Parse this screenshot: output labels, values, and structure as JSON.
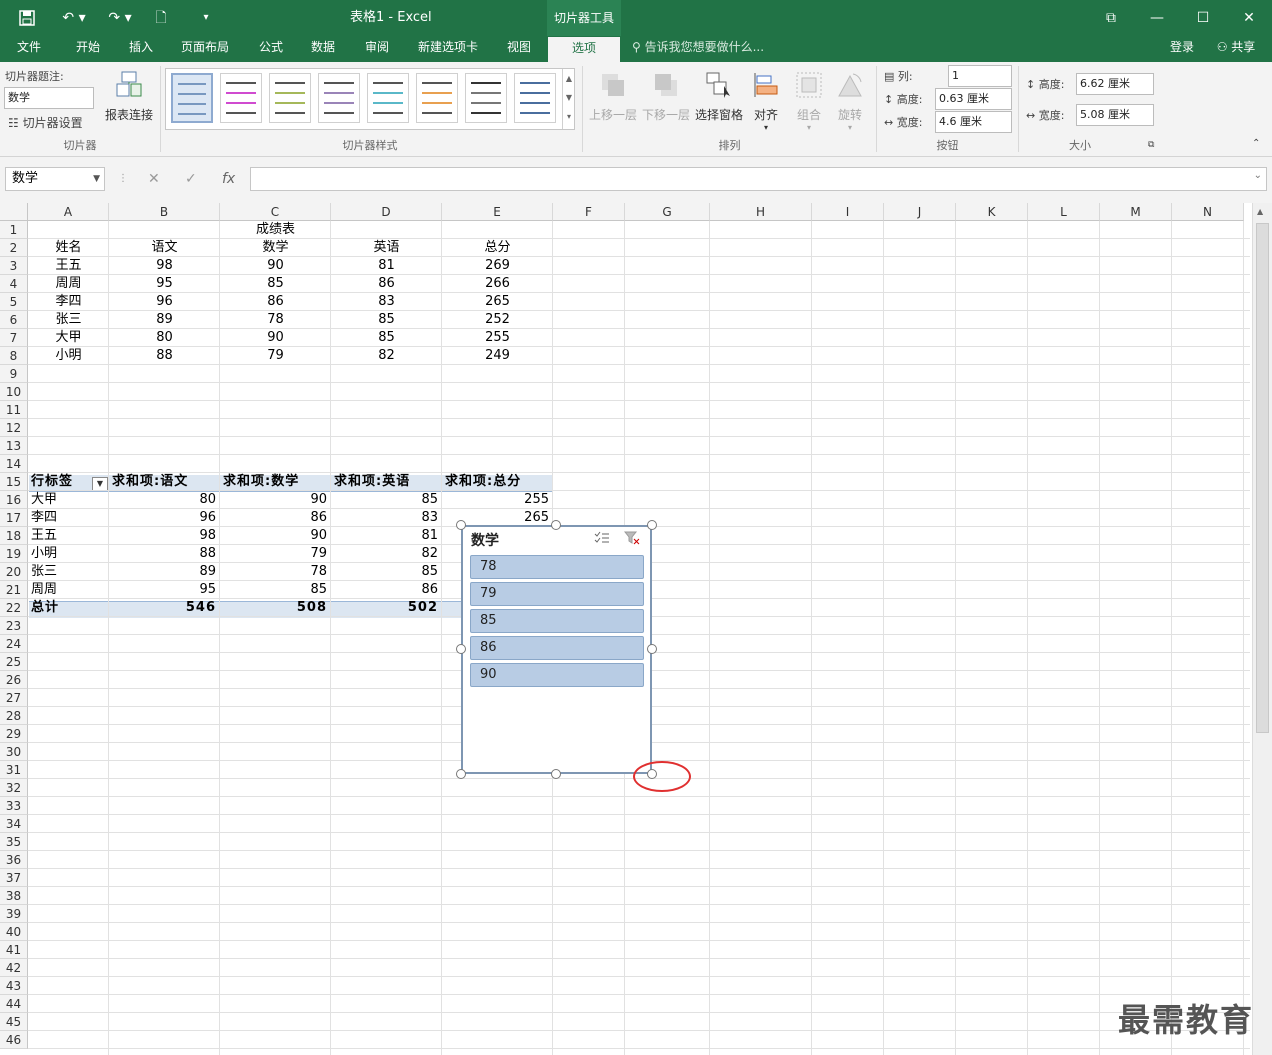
{
  "title": {
    "doc": "表格1 - Excel",
    "context_tab": "切片器工具",
    "login": "登录",
    "share": "共享"
  },
  "menu": {
    "file": "文件",
    "home": "开始",
    "insert": "插入",
    "layout": "页面布局",
    "formula": "公式",
    "data": "数据",
    "review": "审阅",
    "newtab": "新建选项卡",
    "view": "视图",
    "options": "选项",
    "tell": "告诉我您想要做什么..."
  },
  "ribbon": {
    "caption_label": "切片器题注:",
    "caption_value": "数学",
    "settings": "切片器设置",
    "report_conn": "报表连接",
    "group_slicer": "切片器",
    "group_styles": "切片器样式",
    "bring_forward": "上移一层",
    "send_backward": "下移一层",
    "selection_pane": "选择窗格",
    "align": "对齐",
    "group": "组合",
    "rotate": "旋转",
    "group_arrange": "排列",
    "columns_label": "列:",
    "columns_value": "1",
    "btn_height_label": "高度:",
    "btn_height_value": "0.63 厘米",
    "btn_width_label": "宽度:",
    "btn_width_value": "4.6 厘米",
    "group_buttons": "按钮",
    "size_height_label": "高度:",
    "size_height_value": "6.62 厘米",
    "size_width_label": "宽度:",
    "size_width_value": "5.08 厘米",
    "group_size": "大小"
  },
  "formula_bar": {
    "name_box": "数学",
    "fx": "fx",
    "cancel": "✕",
    "enter": "✓"
  },
  "colors": {
    "excel_green": "#217346",
    "slicer_item": "#b8cce4",
    "pivot_header": "#dce6f1"
  },
  "columns": [
    "A",
    "B",
    "C",
    "D",
    "E",
    "F",
    "G",
    "H",
    "I",
    "J",
    "K",
    "L",
    "M",
    "N"
  ],
  "rows": [
    "1",
    "2",
    "3",
    "4",
    "5",
    "6",
    "7",
    "8",
    "9",
    "10",
    "11",
    "12",
    "13",
    "14",
    "15",
    "16",
    "17",
    "18",
    "19",
    "20",
    "21",
    "22",
    "23",
    "24",
    "25",
    "26",
    "27",
    "28",
    "29",
    "30",
    "31",
    "32",
    "33",
    "34",
    "35",
    "36",
    "37",
    "38",
    "39",
    "40",
    "41",
    "42",
    "43",
    "44",
    "45",
    "46"
  ],
  "sheet": {
    "title": "成绩表",
    "headers": [
      "姓名",
      "语文",
      "数学",
      "英语",
      "总分"
    ],
    "data": [
      [
        "王五",
        "98",
        "90",
        "81",
        "269"
      ],
      [
        "周周",
        "95",
        "85",
        "86",
        "266"
      ],
      [
        "李四",
        "96",
        "86",
        "83",
        "265"
      ],
      [
        "张三",
        "89",
        "78",
        "85",
        "252"
      ],
      [
        "大甲",
        "80",
        "90",
        "85",
        "255"
      ],
      [
        "小明",
        "88",
        "79",
        "82",
        "249"
      ]
    ]
  },
  "pivot": {
    "headers": [
      "行标签",
      "求和项:语文",
      "求和项:数学",
      "求和项:英语",
      "求和项:总分"
    ],
    "rows": [
      [
        "大甲",
        "80",
        "90",
        "85",
        "255"
      ],
      [
        "李四",
        "96",
        "86",
        "83",
        "265"
      ],
      [
        "王五",
        "98",
        "90",
        "81",
        ""
      ],
      [
        "小明",
        "88",
        "79",
        "82",
        ""
      ],
      [
        "张三",
        "89",
        "78",
        "85",
        ""
      ],
      [
        "周周",
        "95",
        "85",
        "86",
        ""
      ]
    ],
    "total": [
      "总计",
      "546",
      "508",
      "502"
    ]
  },
  "slicer": {
    "title": "数学",
    "items": [
      "78",
      "79",
      "85",
      "86",
      "90"
    ]
  },
  "watermark": "最需教育"
}
